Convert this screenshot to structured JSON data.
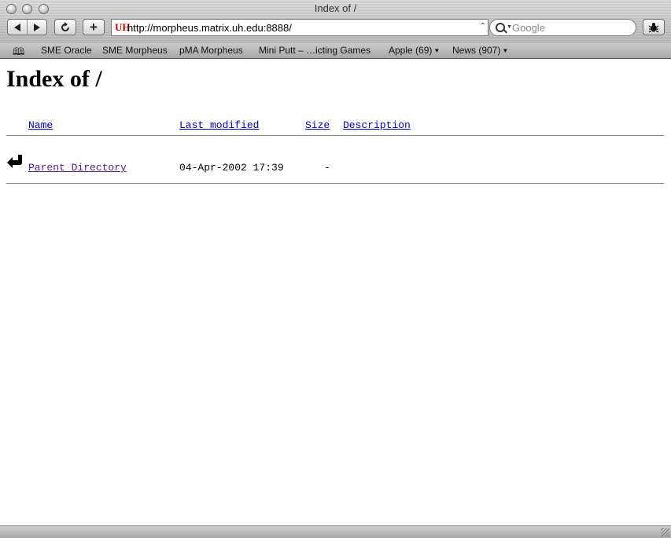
{
  "window": {
    "title": "Index of /"
  },
  "toolbar": {
    "back_icon": "back-arrow-icon",
    "forward_icon": "forward-arrow-icon",
    "reload_icon": "reload-icon",
    "add_label": "+",
    "address": "http://morpheus.matrix.uh.edu:8888/",
    "site_icon_text": "UH",
    "search_placeholder": "Google",
    "bug_icon": "bug-report-icon"
  },
  "bookmarks": {
    "items": [
      {
        "label": "SME Oracle",
        "has_menu": false
      },
      {
        "label": "SME Morpheus",
        "has_menu": false
      },
      {
        "label": "pMA Morpheus",
        "has_menu": false
      },
      {
        "label": "Mini Putt – …icting Games",
        "has_menu": false
      },
      {
        "label": "Apple (69)",
        "has_menu": true
      },
      {
        "label": "News (907)",
        "has_menu": true
      }
    ]
  },
  "page": {
    "heading": "Index of /",
    "columns": {
      "name": "Name",
      "last_modified": "Last modified",
      "size": "Size",
      "description": "Description"
    },
    "rows": [
      {
        "icon": "parent-directory-icon",
        "name": "Parent Directory",
        "last_modified": "04-Apr-2002 17:39",
        "size": "-",
        "description": ""
      }
    ]
  },
  "colors": {
    "link": "#0000c8",
    "visited_link": "#551a8b",
    "site_icon": "#c80000"
  }
}
